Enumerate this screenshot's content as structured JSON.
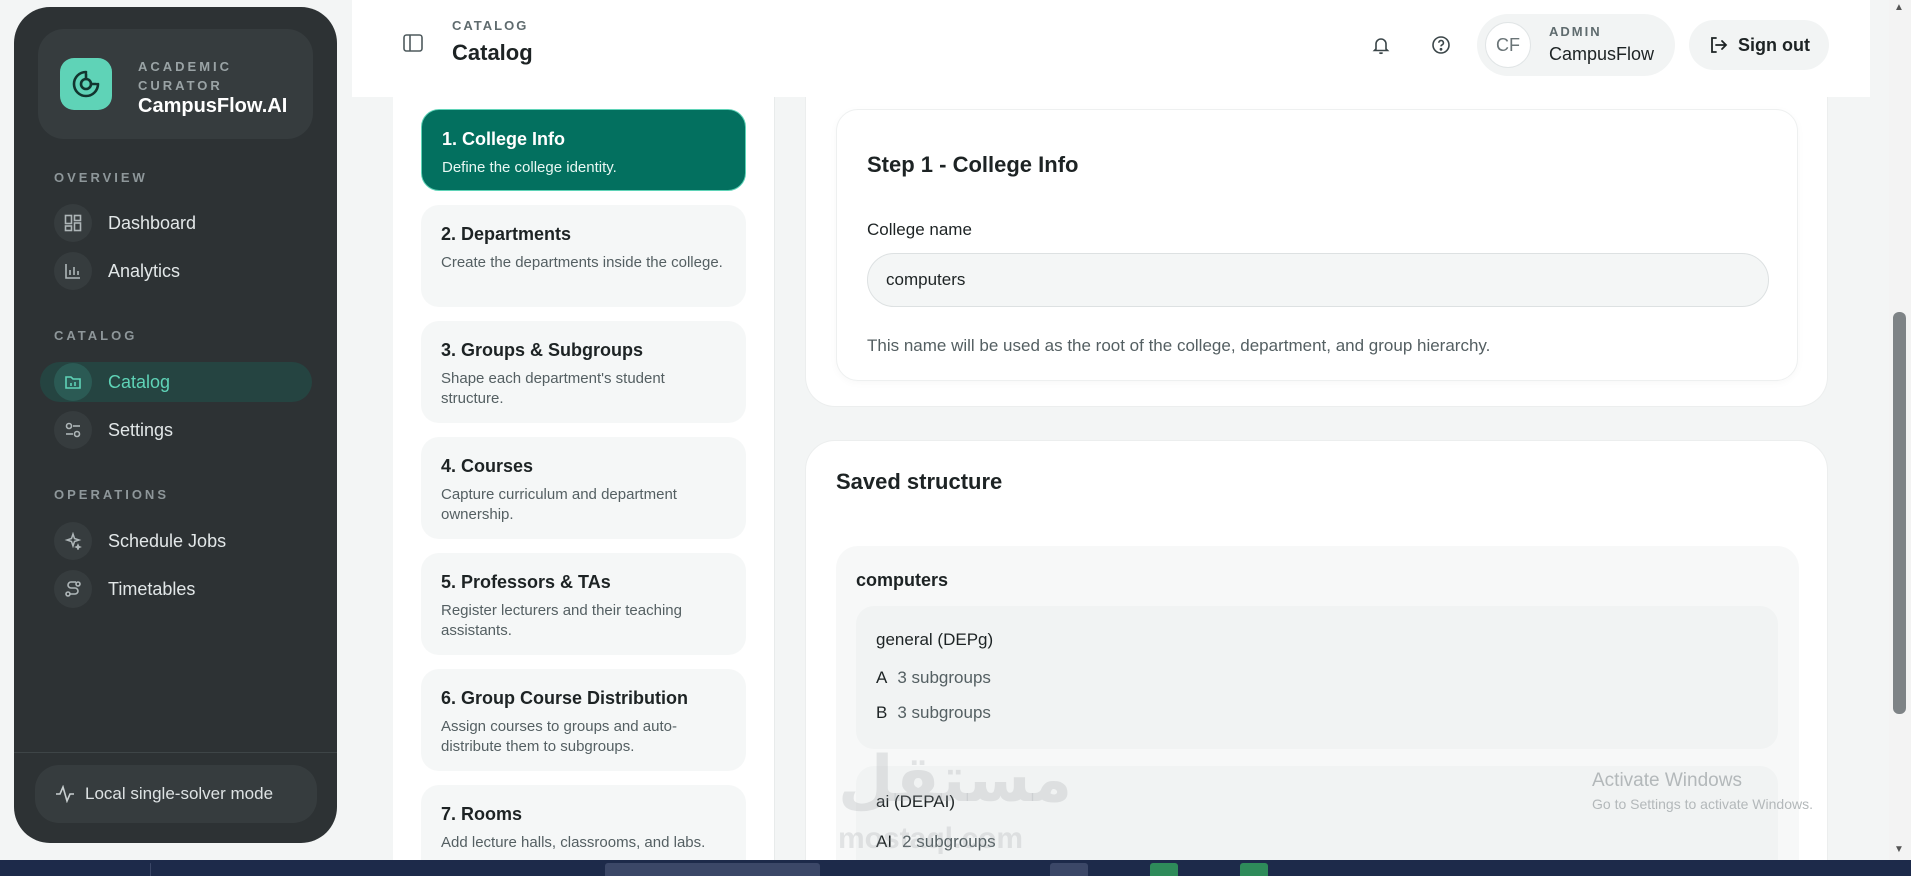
{
  "sidebar": {
    "brand_kicker": "ACADEMIC CURATOR",
    "brand_name": "CampusFlow.AI",
    "sections": [
      {
        "label": "OVERVIEW"
      },
      {
        "label": "CATALOG"
      },
      {
        "label": "OPERATIONS"
      }
    ],
    "items": [
      {
        "label": "Dashboard",
        "icon": "dashboard-icon"
      },
      {
        "label": "Analytics",
        "icon": "analytics-icon"
      },
      {
        "label": "Catalog",
        "icon": "catalog-icon",
        "active": true
      },
      {
        "label": "Settings",
        "icon": "settings-icon"
      },
      {
        "label": "Schedule Jobs",
        "icon": "sparkle-icon"
      },
      {
        "label": "Timetables",
        "icon": "route-icon"
      }
    ],
    "mode_label": "Local single-solver mode"
  },
  "header": {
    "kicker": "CATALOG",
    "title": "Catalog",
    "user_initials": "CF",
    "user_role": "ADMIN",
    "user_name": "CampusFlow",
    "signout_label": "Sign out"
  },
  "steps": [
    {
      "title": "1. College Info",
      "desc": "Define the college identity.",
      "active": true
    },
    {
      "title": "2. Departments",
      "desc": "Create the departments inside the college."
    },
    {
      "title": "3. Groups & Subgroups",
      "desc": "Shape each department's student structure."
    },
    {
      "title": "4. Courses",
      "desc": "Capture curriculum and department ownership."
    },
    {
      "title": "5. Professors & TAs",
      "desc": "Register lecturers and their teaching assistants."
    },
    {
      "title": "6. Group Course Distribution",
      "desc": "Assign courses to groups and auto-distribute them to subgroups."
    },
    {
      "title": "7. Rooms",
      "desc": "Add lecture halls, classrooms, and labs."
    }
  ],
  "main": {
    "step_heading": "Step 1 - College Info",
    "field_label": "College name",
    "field_value": "computers",
    "field_help": "This name will be used as the root of the college, department, and group hierarchy.",
    "saved_title": "Saved structure",
    "college": "computers",
    "departments": [
      {
        "name": "general (DEPg)",
        "groups": [
          {
            "code": "A",
            "info": "3 subgroups"
          },
          {
            "code": "B",
            "info": "3 subgroups"
          }
        ]
      },
      {
        "name": "ai (DEPAI)",
        "groups": [
          {
            "code": "AI",
            "info": "2 subgroups"
          }
        ]
      }
    ]
  },
  "watermarks": {
    "activate_title": "Activate Windows",
    "activate_sub": "Go to Settings to activate Windows.",
    "brand_ar": "مستقل",
    "brand_latin": "mostaql.com"
  },
  "colors": {
    "accent": "#03705f",
    "accent_light": "#5fd3b7",
    "sidebar_bg": "#2d3234"
  }
}
